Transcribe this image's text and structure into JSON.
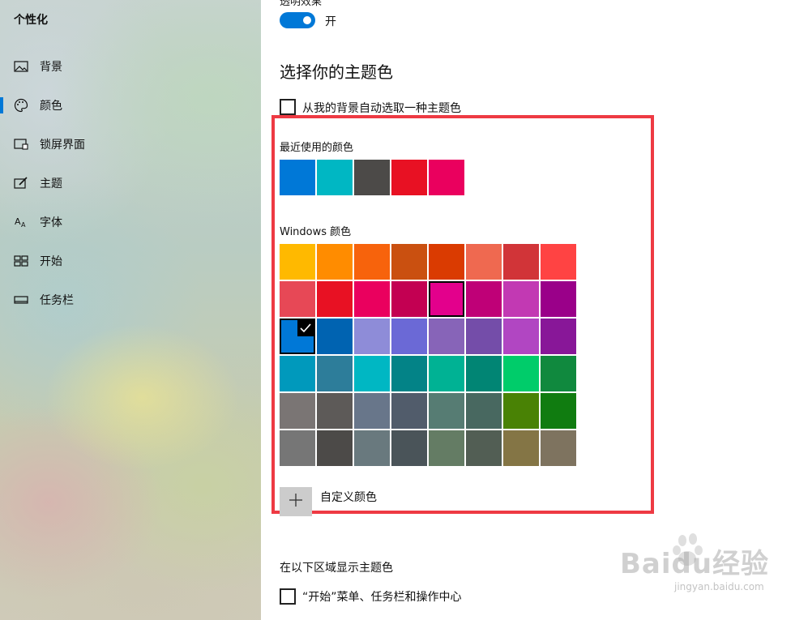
{
  "sidebar": {
    "title": "个性化",
    "items": [
      {
        "label": "背景",
        "icon": "picture-icon",
        "active": false
      },
      {
        "label": "颜色",
        "icon": "palette-icon",
        "active": true
      },
      {
        "label": "锁屏界面",
        "icon": "lockscreen-icon",
        "active": false
      },
      {
        "label": "主题",
        "icon": "theme-brush-icon",
        "active": false
      },
      {
        "label": "字体",
        "icon": "font-icon",
        "active": false
      },
      {
        "label": "开始",
        "icon": "start-icon",
        "active": false
      },
      {
        "label": "任务栏",
        "icon": "taskbar-icon",
        "active": false
      }
    ]
  },
  "main": {
    "cut_label": "透明效果",
    "toggle_state": "开",
    "section_title": "选择你的主题色",
    "auto_pick_label": "从我的背景自动选取一种主题色",
    "recent_label": "最近使用的颜色",
    "recent_colors": [
      "#0078d7",
      "#00b7c3",
      "#4c4a48",
      "#e81123",
      "#ea005e"
    ],
    "windows_label": "Windows 颜色",
    "windows_colors": [
      [
        "#ffb900",
        "#ff8c00",
        "#f7630c",
        "#ca5010",
        "#da3b01",
        "#ef6950",
        "#d13438",
        "#ff4343"
      ],
      [
        "#e74856",
        "#e81123",
        "#ea005e",
        "#c30052",
        "#e3008c",
        "#bf0077",
        "#c239b3",
        "#9a0089"
      ],
      [
        "#0078d7",
        "#0063b1",
        "#8e8cd8",
        "#6b69d6",
        "#8764b8",
        "#744da9",
        "#b146c2",
        "#881798"
      ],
      [
        "#0099bc",
        "#2d7d9a",
        "#00b7c3",
        "#038387",
        "#00b294",
        "#018574",
        "#00cc6a",
        "#10893e"
      ],
      [
        "#7a7574",
        "#5d5a58",
        "#68768a",
        "#515c6b",
        "#567c73",
        "#486860",
        "#498205",
        "#107c10"
      ],
      [
        "#767676",
        "#4c4a48",
        "#69797e",
        "#4a5459",
        "#647c64",
        "#525e54",
        "#847545",
        "#7e735f"
      ]
    ],
    "selected_color": "#0078d7",
    "custom_label": "自定义颜色",
    "show_accent_label": "在以下区域显示主题色",
    "start_taskbar_label": "“开始”菜单、任务栏和操作中心"
  },
  "accent_color": "#0078d7",
  "highlight_color": "#ee3a43",
  "watermark": {
    "brand": "Baidu经验",
    "url": "jingyan.baidu.com"
  }
}
